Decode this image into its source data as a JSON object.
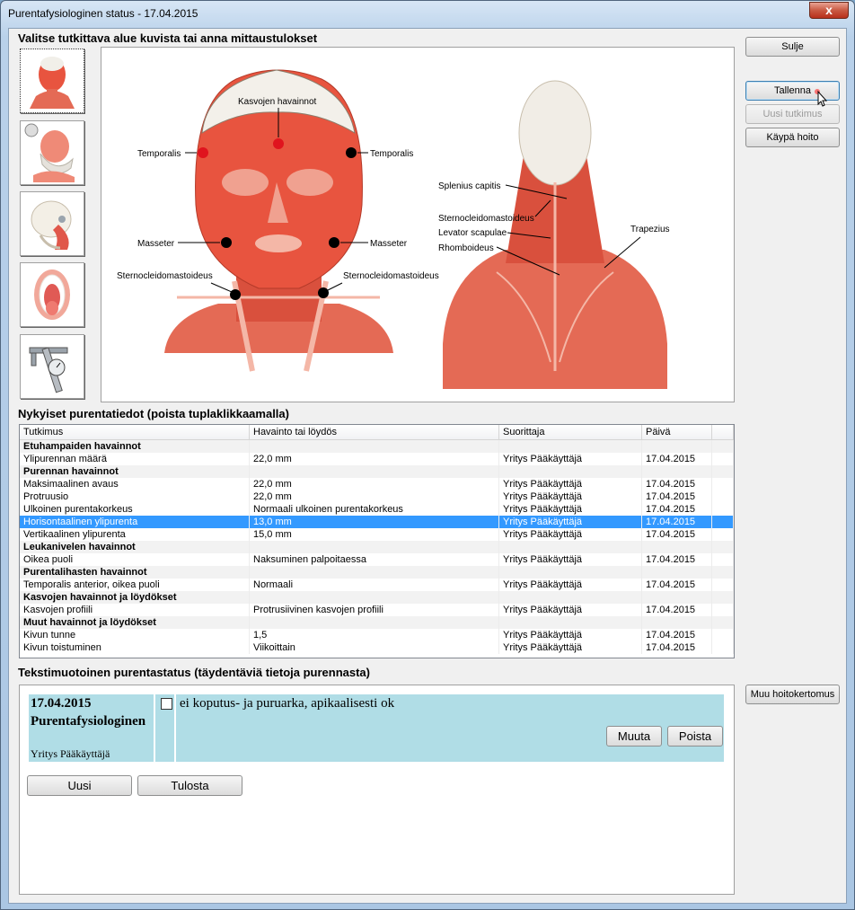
{
  "window": {
    "title": "Purentafysiologinen status  -  17.04.2015",
    "close_glyph": "x"
  },
  "labels": {
    "select_area": "Valitse tutkittava alue kuvista tai anna mittaustulokset",
    "current_data": "Nykyiset purentatiedot (poista tuplaklikkaamalla)",
    "text_status": "Tekstimuotoinen purentastatus (täydentäviä tietoja purennasta)"
  },
  "buttons": {
    "close": "Sulje",
    "save": "Tallenna",
    "new_exam": "Uusi tutkimus",
    "care_guide": "Käypä hoito",
    "other_report": "Muu hoitokertomus",
    "edit": "Muuta",
    "delete": "Poista",
    "new": "Uusi",
    "print": "Tulosta"
  },
  "thumbnails": [
    {
      "icon": "face-muscles-icon",
      "selected": true
    },
    {
      "icon": "jaw-joint-icon",
      "selected": false
    },
    {
      "icon": "skull-side-icon",
      "selected": false
    },
    {
      "icon": "open-mouth-icon",
      "selected": false
    },
    {
      "icon": "caliper-icon",
      "selected": false
    }
  ],
  "anatomy": {
    "front_labels": {
      "kasvojen": "Kasvojen havainnot",
      "temporalis_left": "Temporalis",
      "temporalis_right": "Temporalis",
      "masseter_left": "Masseter",
      "masseter_right": "Masseter",
      "scm_left": "Sternocleidomastoideus",
      "scm_right": "Sternocleidomastoideus"
    },
    "back_labels": {
      "splenius": "Splenius capitis",
      "scm": "Sternocleidomastoideus",
      "levator": "Levator scapulae",
      "rhomboideus": "Rhomboideus",
      "trapezius": "Trapezius"
    },
    "marker_colors": {
      "active": "#e0141e",
      "inactive": "#000000"
    }
  },
  "grid": {
    "headers": [
      "Tutkimus",
      "Havainto tai löydös",
      "Suorittaja",
      "Päivä"
    ],
    "rows": [
      {
        "group": true,
        "cells": [
          "Etuhampaiden havainnot",
          "",
          "",
          ""
        ]
      },
      {
        "cells": [
          "Ylipurennan määrä",
          "22,0 mm",
          "Yritys  Pääkäyttäjä",
          "17.04.2015"
        ]
      },
      {
        "group": true,
        "cells": [
          "Purennan havainnot",
          "",
          "",
          ""
        ]
      },
      {
        "cells": [
          "Maksimaalinen avaus",
          "22,0 mm",
          "Yritys  Pääkäyttäjä",
          "17.04.2015"
        ]
      },
      {
        "cells": [
          "Protruusio",
          "22,0 mm",
          "Yritys  Pääkäyttäjä",
          "17.04.2015"
        ]
      },
      {
        "cells": [
          "Ulkoinen purentakorkeus",
          "Normaali ulkoinen purentakorkeus",
          "Yritys  Pääkäyttäjä",
          "17.04.2015"
        ]
      },
      {
        "selected": true,
        "cells": [
          "Horisontaalinen ylipurenta",
          "13,0 mm",
          "Yritys  Pääkäyttäjä",
          "17.04.2015"
        ]
      },
      {
        "cells": [
          "Vertikaalinen ylipurenta",
          "15,0 mm",
          "Yritys  Pääkäyttäjä",
          "17.04.2015"
        ]
      },
      {
        "group": true,
        "cells": [
          "Leukanivelen havainnot",
          "",
          "",
          ""
        ]
      },
      {
        "cells": [
          "Oikea puoli",
          "Naksuminen palpoitaessa",
          "Yritys  Pääkäyttäjä",
          "17.04.2015"
        ]
      },
      {
        "group": true,
        "cells": [
          "Purentalihasten havainnot",
          "",
          "",
          ""
        ]
      },
      {
        "cells": [
          "Temporalis anterior, oikea puoli",
          "Normaali",
          "Yritys  Pääkäyttäjä",
          "17.04.2015"
        ]
      },
      {
        "group": true,
        "cells": [
          "Kasvojen havainnot ja löydökset",
          "",
          "",
          ""
        ]
      },
      {
        "cells": [
          "Kasvojen profiili",
          "Protrusiivinen kasvojen profiili",
          "Yritys  Pääkäyttäjä",
          "17.04.2015"
        ]
      },
      {
        "group": true,
        "cells": [
          "Muut havainnot ja löydökset",
          "",
          "",
          ""
        ]
      },
      {
        "cells": [
          "Kivun tunne",
          "1,5",
          "Yritys  Pääkäyttäjä",
          "17.04.2015"
        ]
      },
      {
        "cells": [
          "Kivun toistuminen",
          "Viikoittain",
          "Yritys  Pääkäyttäjä",
          "17.04.2015"
        ]
      }
    ]
  },
  "entry": {
    "date": "17.04.2015",
    "type": "Purentafysiologinen",
    "user": "Yritys Pääkäyttäjä",
    "text": "ei koputus- ja puruarka, apikaalisesti ok",
    "checked": false
  }
}
